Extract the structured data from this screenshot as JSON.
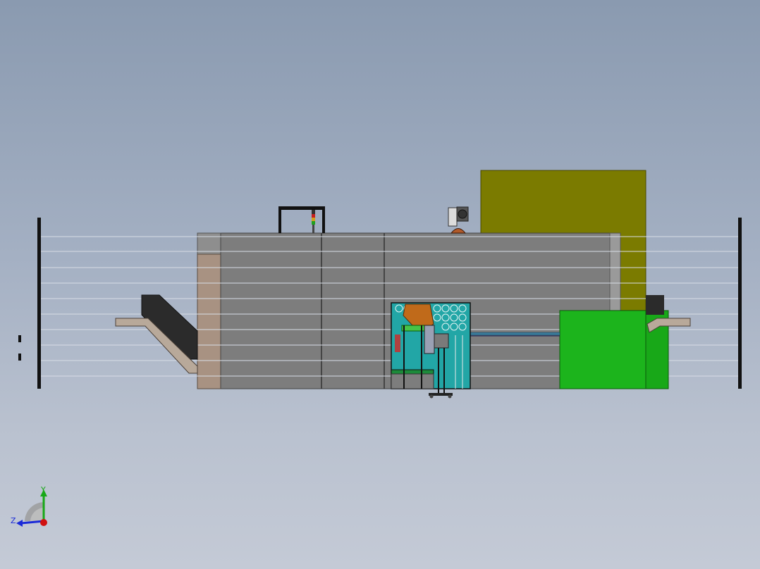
{
  "viewport": {
    "background_top": "#8a9ab0",
    "background_bottom": "#c4cad6"
  },
  "model": {
    "colors": {
      "enclosure_panel": "#7d7d7d",
      "enclosure_edge": "#9a9a9a",
      "tan_panel": "#a89282",
      "olive_cabinet": "#7b7b00",
      "green_cabinet": "#1cb41c",
      "stair_dark": "#2b2b2b",
      "stair_tan": "#b8a99a",
      "teal_cell": "#22a6a6",
      "robot_orange": "#c06a1a",
      "fence_post": "#111111",
      "fence_wire": "#d8dde6"
    }
  },
  "triad": {
    "y_label": "Y",
    "z_label": "Z",
    "y_color": "#18a818",
    "z_color": "#1a2ad8",
    "x_color": "#d01010"
  }
}
